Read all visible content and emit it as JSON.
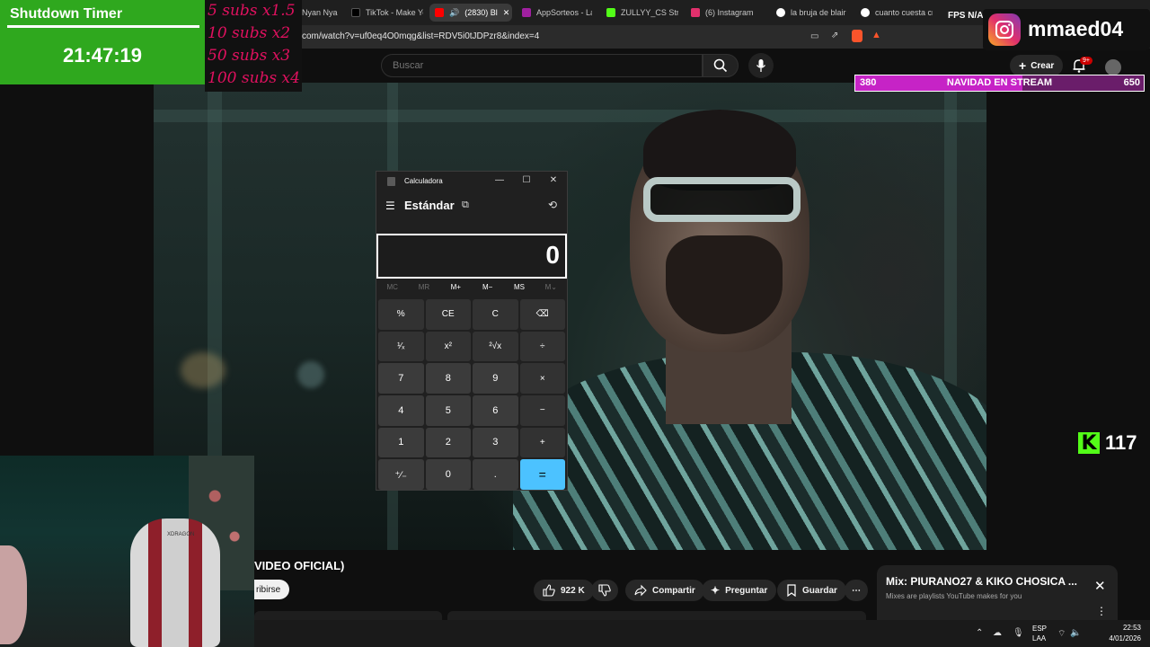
{
  "browser": {
    "tabs": [
      {
        "label": "Nyan Nya",
        "color": "#777"
      },
      {
        "label": "TikTok - Make Yo",
        "color": "#222"
      },
      {
        "label": "(2830) Bl",
        "color": "#ff0000",
        "active": true
      },
      {
        "label": "AppSorteos - La",
        "color": "#a020a0"
      },
      {
        "label": "ZULLYY_CS Strea",
        "color": "#53fc18"
      },
      {
        "label": "(6) Instagram",
        "color": "#e1306c"
      },
      {
        "label": "la bruja de blair",
        "color": "#ffffff"
      },
      {
        "label": "cuanto cuesta cr",
        "color": "#ffffff"
      }
    ],
    "url": "com/watch?v=uf0eq4O0mqg&list=RDV5i0tJDPzr8&index=4"
  },
  "youtube": {
    "search_placeholder": "Buscar",
    "create_label": "Crear",
    "notifications_badge": "9+",
    "video_title": "VIDEO OFICIAL)",
    "subscribe_label": "ribirse",
    "likes": "922 K",
    "share_label": "Compartir",
    "ask_label": "Preguntar",
    "save_label": "Guardar",
    "more_label": "⋯",
    "mix": {
      "title": "Mix: PIURANO27 & KIKO CHOSICA ...",
      "subtitle": "Mixes are playlists YouTube makes for you"
    }
  },
  "taskbar": {
    "lang_top": "ESP",
    "lang_bottom": "LAA",
    "time": "22:53",
    "date": "4/01/2026"
  },
  "overlays": {
    "timer": {
      "title": "Shutdown Timer",
      "value": "21:47:19"
    },
    "subs_goals": [
      "5 subs x1.5",
      "10 subs x2",
      "50 subs x3",
      "100 subs x4"
    ],
    "instagram_handle": "mmaed04",
    "fps": "FPS N/A",
    "christmas_bar": {
      "current": "380",
      "label": "NAVIDAD EN STREAM",
      "goal": "650",
      "progress": 0.58
    },
    "kick": {
      "letter": "K",
      "count": "117"
    },
    "chair_brand": "XDRAGON"
  },
  "calculator": {
    "window_title": "Calculadora",
    "mode": "Estándar",
    "display": "0",
    "memory": [
      "MC",
      "MR",
      "M+",
      "M−",
      "MS",
      "M⌄"
    ],
    "keys": [
      "%",
      "CE",
      "C",
      "⌫",
      "¹⁄ₓ",
      "x²",
      "²√x",
      "÷",
      "7",
      "8",
      "9",
      "×",
      "4",
      "5",
      "6",
      "−",
      "1",
      "2",
      "3",
      "+",
      "⁺⁄₋",
      "0",
      ".",
      "="
    ]
  }
}
